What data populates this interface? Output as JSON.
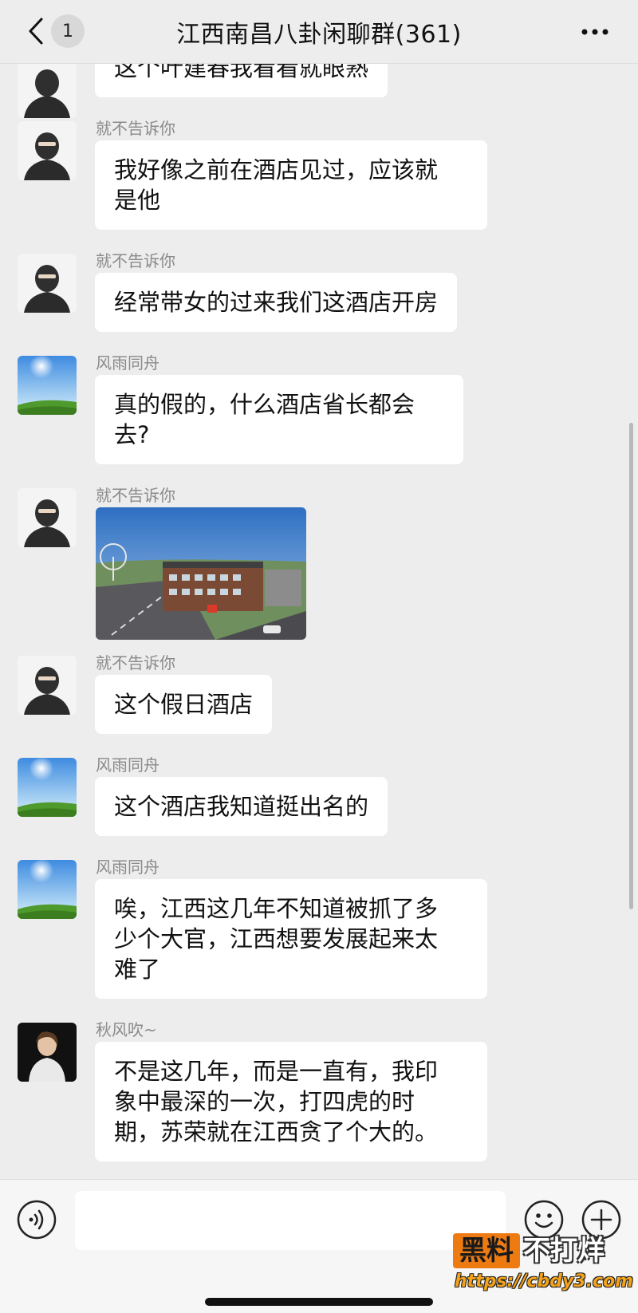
{
  "header": {
    "back_badge": "1",
    "title": "江西南昌八卦闲聊群(361)"
  },
  "messages": [
    {
      "sender": "",
      "avatar": "masked-man",
      "text": "这个叶建春我看看就眼熟"
    },
    {
      "sender": "就不告诉你",
      "avatar": "masked-man",
      "text": "我好像之前在酒店见过，应该就\n是他"
    },
    {
      "sender": "就不告诉你",
      "avatar": "masked-man",
      "text": "经常带女的过来我们这酒店开房"
    },
    {
      "sender": "风雨同舟",
      "avatar": "sky-landscape",
      "text": "真的假的，什么酒店省长都会\n去?"
    },
    {
      "sender": "就不告诉你",
      "avatar": "masked-man",
      "image": "hotel-photo"
    },
    {
      "sender": "就不告诉你",
      "avatar": "masked-man",
      "text": "这个假日酒店"
    },
    {
      "sender": "风雨同舟",
      "avatar": "sky-landscape",
      "text": "这个酒店我知道挺出名的"
    },
    {
      "sender": "风雨同舟",
      "avatar": "sky-landscape",
      "text": "唉，江西这几年不知道被抓了多\n少个大官，江西想要发展起来太\n难了"
    },
    {
      "sender": "秋风吹~",
      "avatar": "woman-portrait",
      "text": "不是这几年，而是一直有，我印\n象中最深的一次，打四虎的时\n期，苏荣就在江西贪了个大的。"
    }
  ],
  "input": {
    "value": "",
    "placeholder": ""
  },
  "watermark": {
    "part1": "黑料",
    "part2": "不打烊",
    "url": "https://cbdy3.com"
  },
  "colors": {
    "background": "#ededed",
    "bubble": "#ffffff",
    "watermark_accent": "#ee7a12"
  }
}
